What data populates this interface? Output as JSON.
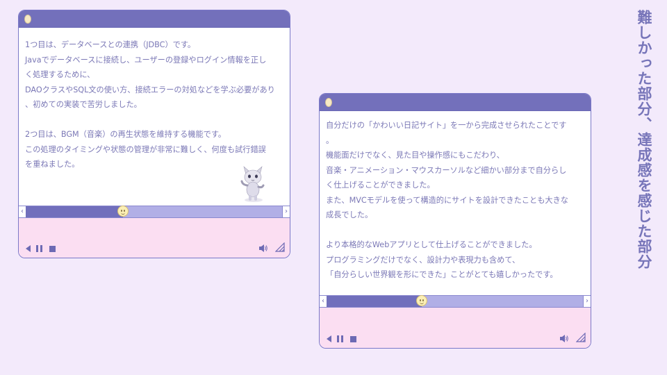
{
  "heading": "難しかった部分、達成感を感じた部分",
  "window_left": {
    "lines": [
      "1つ目は、データベースとの連携（JDBC）です。",
      "Javaでデータベースに接続し、ユーザーの登録やログイン情報を正し",
      "く処理するために、",
      "DAOクラスやSQL文の使い方、接続エラーの対処などを学ぶ必要があり",
      "、初めての実装で苦労しました。",
      "",
      "2つ目は、BGM（音楽）の再生状態を維持する機能です。",
      "この処理のタイミングや状態の管理が非常に難しく、何度も試行錯誤",
      "を重ねました。"
    ],
    "scroll_position": 0.38
  },
  "window_right": {
    "lines": [
      "自分だけの「かわいい日記サイト」を一から完成させられたことです",
      "。",
      "機能面だけでなく、見た目や操作感にもこだわり、",
      "音楽・アニメーション・マウスカーソルなど細かい部分まで自分らし",
      "く仕上げることができました。",
      "また、MVCモデルを使って構造的にサイトを設計できたことも大きな",
      "成長でした。",
      "",
      "より本格的なWebアプリとして仕上げることができました。",
      "プログラミングだけでなく、設計力や表現力も含めて、",
      "「自分らしい世界観を形にできた」ことがとても嬉しかったです。"
    ],
    "scroll_position": 0.37
  },
  "icons": {
    "title_dot": "circle-icon",
    "scroll_left": "chevron-left-icon",
    "scroll_right": "chevron-right-icon",
    "thumb": "smiley-face-icon",
    "prev": "play-back-icon",
    "pause": "pause-icon",
    "stop": "stop-icon",
    "volume": "speaker-icon",
    "resize": "resize-handle-icon",
    "mascot": "cat-mascot-icon"
  },
  "colors": {
    "background": "#f3eafb",
    "titlebar": "#7370bb",
    "text": "#7b78b6",
    "scroll_track": "#b1afe6",
    "scroll_fill": "#716fbc",
    "player_bg": "#fbdef2"
  }
}
